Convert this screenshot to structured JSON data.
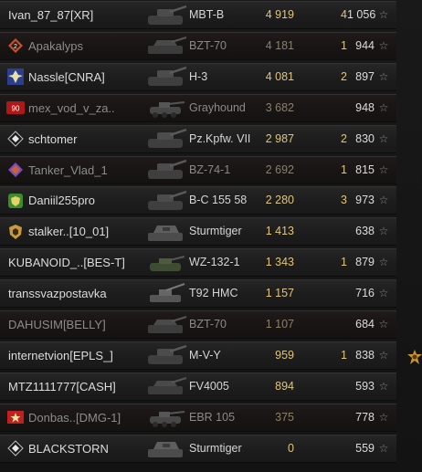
{
  "players": [
    {
      "name": "Ivan_87_87[XR]",
      "emblem": "none",
      "emblem_color": "",
      "vehicle": "MBT-B",
      "tank_icon": "heavy-tank-icon",
      "damage": "4 919",
      "kills": "4",
      "xp": "1 056",
      "destroyed": false
    },
    {
      "name": "Apakalyps",
      "emblem": "rank-2-badge-icon",
      "emblem_color": "#c8512a",
      "vehicle": "BZT-70",
      "tank_icon": "tank-destroyer-icon",
      "damage": "4 181",
      "kills": "1",
      "xp": "944",
      "destroyed": true
    },
    {
      "name": "Nassle[CNRA]",
      "emblem": "clan-crest-icon",
      "emblem_color": "#2c3e8c",
      "vehicle": "H-3",
      "tank_icon": "heavy-tank-icon",
      "damage": "4 081",
      "kills": "2",
      "xp": "897",
      "destroyed": false
    },
    {
      "name": "mex_vod_v_za..",
      "emblem": "red-badge-icon",
      "emblem_color": "#b01818",
      "vehicle": "Grayhound",
      "tank_icon": "armored-car-icon",
      "damage": "3 682",
      "kills": "",
      "xp": "948",
      "destroyed": true
    },
    {
      "name": "schtomer",
      "emblem": "diamond-rank-icon",
      "emblem_color": "#c0c0c0",
      "vehicle": "Pz.Kpfw. VII",
      "tank_icon": "heavy-tank-icon",
      "damage": "2 987",
      "kills": "2",
      "xp": "830",
      "destroyed": false
    },
    {
      "name": "Tanker_Vlad_1",
      "emblem": "purple-diamond-icon",
      "emblem_color": "#7a4cc4",
      "vehicle": "BZ-74-1",
      "tank_icon": "heavy-tank-icon",
      "damage": "2 692",
      "kills": "1",
      "xp": "815",
      "destroyed": true
    },
    {
      "name": "Daniil255pro",
      "emblem": "green-shield-icon",
      "emblem_color": "#3c8c2c",
      "vehicle": "B-C 155 58",
      "tank_icon": "heavy-tank-icon",
      "damage": "2 280",
      "kills": "3",
      "xp": "973",
      "destroyed": false
    },
    {
      "name": "stalker..[10_01]",
      "emblem": "gold-shield-icon",
      "emblem_color": "#c89a3a",
      "vehicle": "Sturmtiger",
      "tank_icon": "assault-gun-icon",
      "damage": "1 413",
      "kills": "",
      "xp": "638",
      "destroyed": false
    },
    {
      "name": "KUBANOID_..[BES-T]",
      "emblem": "none",
      "emblem_color": "",
      "vehicle": "WZ-132-1",
      "tank_icon": "light-tank-icon",
      "damage": "1 343",
      "kills": "1",
      "xp": "879",
      "destroyed": false
    },
    {
      "name": "transsvazpostavka",
      "emblem": "none",
      "emblem_color": "",
      "vehicle": "T92 HMC",
      "tank_icon": "artillery-icon",
      "damage": "1 157",
      "kills": "",
      "xp": "716",
      "destroyed": false
    },
    {
      "name": "DAHUSIM[BELLY]",
      "emblem": "none",
      "emblem_color": "",
      "vehicle": "BZT-70",
      "tank_icon": "tank-destroyer-icon",
      "damage": "1 107",
      "kills": "",
      "xp": "684",
      "destroyed": true
    },
    {
      "name": "internetvion[EPLS_]",
      "emblem": "none",
      "emblem_color": "",
      "vehicle": "M-V-Y",
      "tank_icon": "heavy-tank-icon",
      "damage": "959",
      "kills": "1",
      "xp": "838",
      "destroyed": false
    },
    {
      "name": "MTZ1111777[CASH]",
      "emblem": "none",
      "emblem_color": "",
      "vehicle": "FV4005",
      "tank_icon": "tank-destroyer-icon",
      "damage": "894",
      "kills": "",
      "xp": "593",
      "destroyed": false
    },
    {
      "name": "Donbas..[DMG-1]",
      "emblem": "red-star-badge-icon",
      "emblem_color": "#c02020",
      "vehicle": "EBR 105",
      "tank_icon": "armored-car-icon",
      "damage": "375",
      "kills": "",
      "xp": "778",
      "destroyed": true
    },
    {
      "name": "BLACKSTORN",
      "emblem": "diamond-rank-icon",
      "emblem_color": "#c0c0c0",
      "vehicle": "Sturmtiger",
      "tank_icon": "assault-gun-icon",
      "damage": "0",
      "kills": "",
      "xp": "559",
      "destroyed": false
    }
  ],
  "xp_suffix_icon": "star-icon",
  "side_medal_icon": "medal-icon",
  "colors": {
    "damage_text": "#e0c47a",
    "name_text": "#dcdcdc",
    "destroyed_text": "#8c8c8c"
  }
}
